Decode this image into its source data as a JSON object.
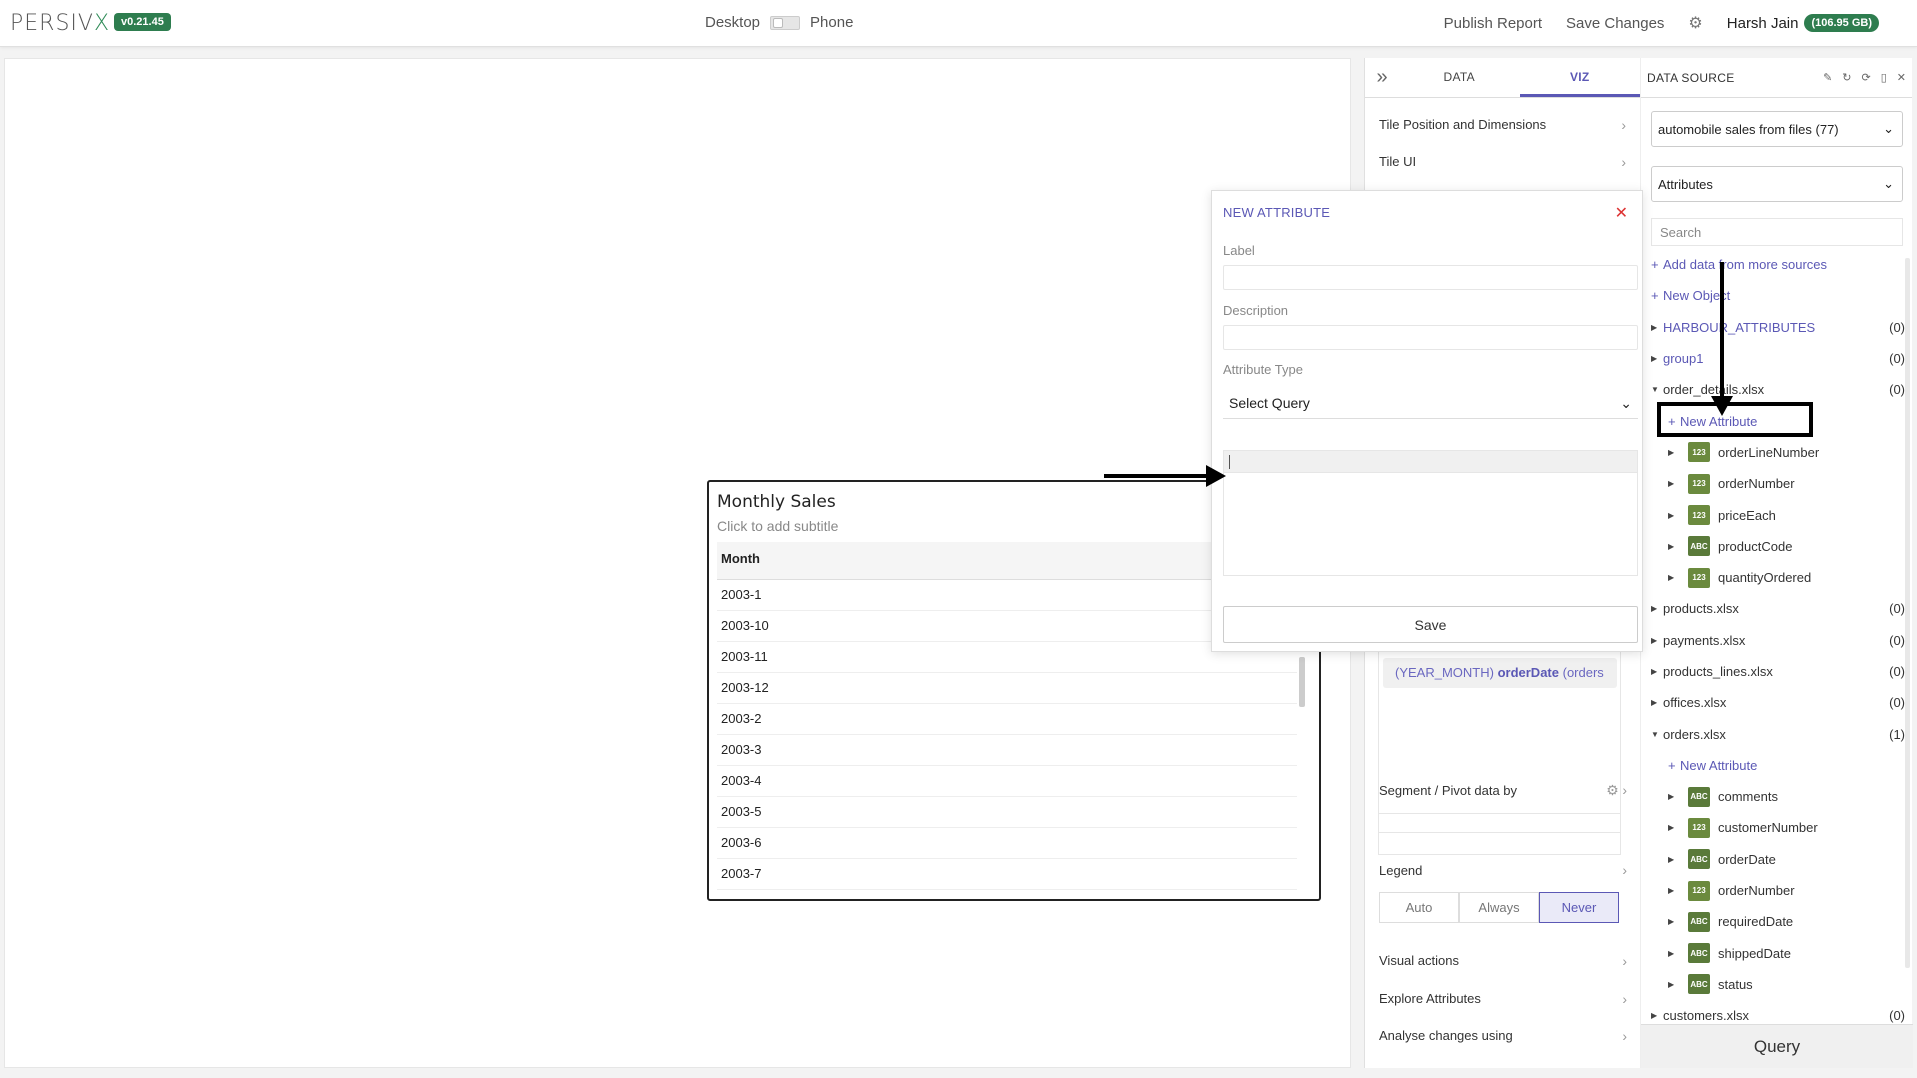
{
  "header": {
    "logo_text": "PERSIV",
    "logo_x": "X",
    "version": "v0.21.45",
    "desktop_label": "Desktop",
    "phone_label": "Phone",
    "publish_label": "Publish Report",
    "save_changes_label": "Save Changes",
    "user_name": "Harsh Jain",
    "storage": "(106.95 GB)"
  },
  "tile": {
    "title": "Monthly Sales",
    "subtitle": "Click to add subtitle",
    "column": "Month",
    "rows": [
      "2003-1",
      "2003-10",
      "2003-11",
      "2003-12",
      "2003-2",
      "2003-3",
      "2003-4",
      "2003-5",
      "2003-6",
      "2003-7"
    ]
  },
  "viz_panel": {
    "tabs": [
      "DATA",
      "VIZ"
    ],
    "active_tab": "VIZ",
    "tile_position": "Tile Position and Dimensions",
    "tile_ui": "Tile UI",
    "pill_prefix": "(YEAR_MONTH)",
    "pill_field": "orderDate",
    "pill_suffix": "(orders",
    "segment_label": "Segment / Pivot data by",
    "legend_label": "Legend",
    "legend_options": [
      "Auto",
      "Always",
      "Never"
    ],
    "legend_active": "Never",
    "visual_actions": "Visual actions",
    "explore_attributes": "Explore Attributes",
    "analyse_changes": "Analyse changes using"
  },
  "data_source": {
    "title": "DATA SOURCE",
    "source_select": "automobile sales from files (77)",
    "type_select": "Attributes",
    "search_placeholder": "Search",
    "add_data": "Add data from more sources",
    "new_object": "New Object",
    "groups": [
      {
        "name": "HARBOUR_ATTRIBUTES",
        "count": "(0)"
      },
      {
        "name": "group1",
        "count": "(0)"
      },
      {
        "name": "order_details.xlsx",
        "count": "(0)"
      },
      {
        "name": "products.xlsx",
        "count": "(0)"
      },
      {
        "name": "payments.xlsx",
        "count": "(0)"
      },
      {
        "name": "products_lines.xlsx",
        "count": "(0)"
      },
      {
        "name": "offices.xlsx",
        "count": "(0)"
      },
      {
        "name": "orders.xlsx",
        "count": "(1)"
      },
      {
        "name": "customers.xlsx",
        "count": "(0)"
      }
    ],
    "new_attribute": "New Attribute",
    "order_details_fields": [
      {
        "type": "123",
        "name": "orderLineNumber"
      },
      {
        "type": "123",
        "name": "orderNumber"
      },
      {
        "type": "123",
        "name": "priceEach"
      },
      {
        "type": "ABC",
        "name": "productCode"
      },
      {
        "type": "123",
        "name": "quantityOrdered"
      }
    ],
    "orders_fields": [
      {
        "type": "ABC",
        "name": "comments"
      },
      {
        "type": "123",
        "name": "customerNumber"
      },
      {
        "type": "ABC",
        "name": "orderDate"
      },
      {
        "type": "123",
        "name": "orderNumber"
      },
      {
        "type": "ABC",
        "name": "requiredDate"
      },
      {
        "type": "ABC",
        "name": "shippedDate"
      },
      {
        "type": "ABC",
        "name": "status"
      }
    ],
    "query_label": "Query"
  },
  "modal": {
    "title": "NEW ATTRIBUTE",
    "label_field": "Label",
    "description_field": "Description",
    "attribute_type_field": "Attribute Type",
    "attribute_type_value": "Select Query",
    "save_label": "Save"
  },
  "colors": {
    "accent": "#5b58b5",
    "badge_green": "#2e7d4f",
    "type_icon": "#5a7a3a",
    "close_red": "#dd3333"
  }
}
